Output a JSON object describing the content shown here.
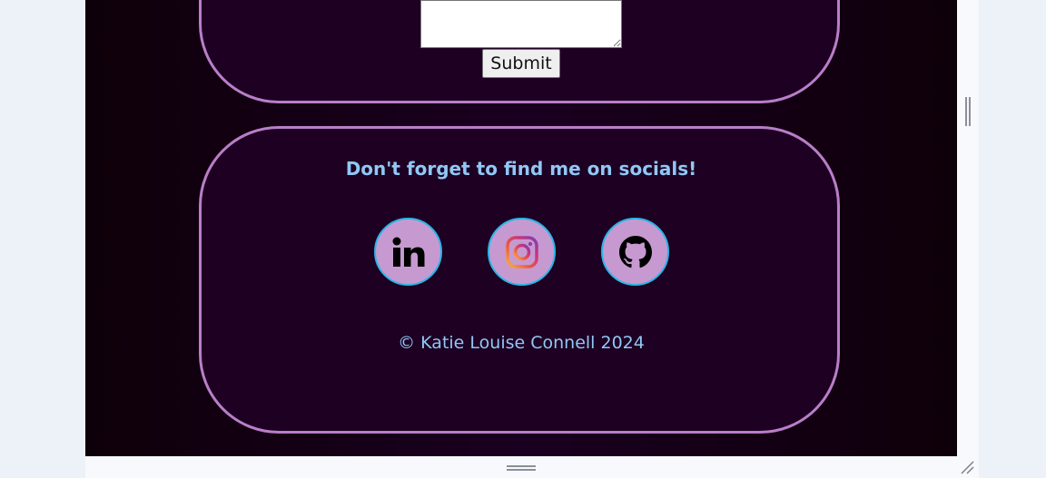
{
  "contact_form": {
    "message_value": "",
    "submit_label": "Submit"
  },
  "socials": {
    "heading": "Don't forget to find me on socials!",
    "links": [
      {
        "icon": "linkedin-icon",
        "label": "LinkedIn"
      },
      {
        "icon": "instagram-icon",
        "label": "Instagram"
      },
      {
        "icon": "github-icon",
        "label": "GitHub"
      }
    ]
  },
  "footer": {
    "copyright": "© Katie Louise Connell 2024"
  },
  "colors": {
    "page_background": "#1a0020",
    "card_border": "#b97ec9",
    "heading_text": "#91c7f5",
    "icon_circle": "#c69ad0",
    "icon_ring": "#2ab4e8"
  }
}
